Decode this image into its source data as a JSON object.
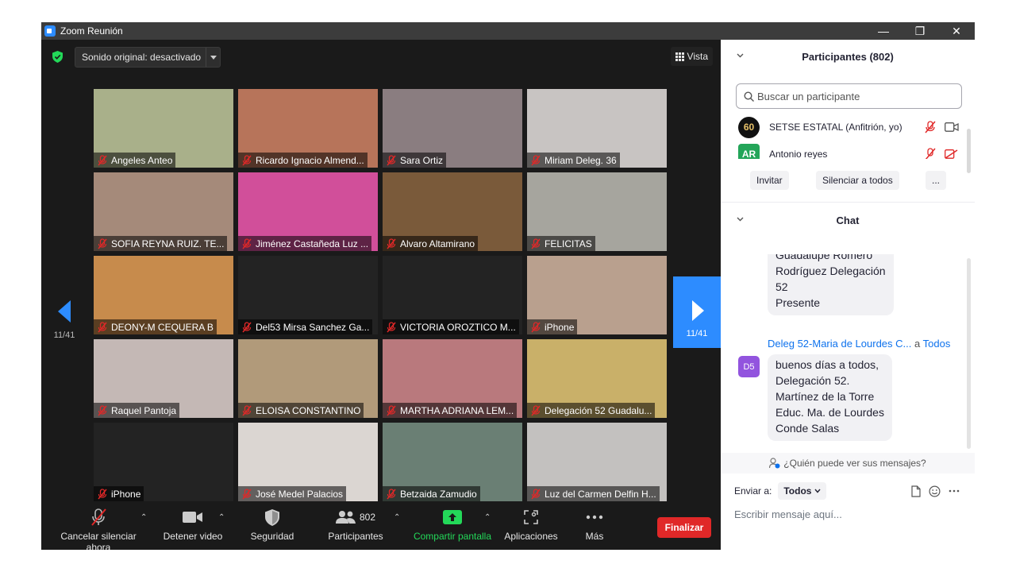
{
  "window": {
    "title": "Zoom Reunión",
    "minimize": "—",
    "restore": "❐",
    "close": "✕"
  },
  "topbar": {
    "sound_label": "Sonido original: desactivado",
    "view_label": "Vista"
  },
  "colors": {
    "accent": "#2d8cff",
    "danger": "#e02828",
    "muted_mic": "#e02828"
  },
  "grid": {
    "tiles": [
      {
        "name": "Angeles Anteo",
        "bg": "#a9b08a"
      },
      {
        "name": "Ricardo Ignacio Almend...",
        "bg": "#b7745a"
      },
      {
        "name": "Sara Ortiz",
        "bg": "#8a7d80"
      },
      {
        "name": "Miriam Deleg. 36",
        "bg": "#c8c4c2"
      },
      {
        "name": "SOFIA  REYNA  RUIZ. TE...",
        "bg": "#a58a7a"
      },
      {
        "name": "Jiménez Castañeda Luz ...",
        "bg": "#d14f9a"
      },
      {
        "name": "Alvaro Altamirano",
        "bg": "#7a5a3a"
      },
      {
        "name": "FELICITAS",
        "bg": "#a6a59e"
      },
      {
        "name": "DEONY-M CEQUERA B",
        "bg": "#c78b4c"
      },
      {
        "name": "Del53 Mirsa Sanchez Ga...",
        "bg": "#232323"
      },
      {
        "name": "VICTORIA OROZTICO M...",
        "bg": "#232323"
      },
      {
        "name": "iPhone",
        "bg": "#b9a08e"
      },
      {
        "name": "Raquel Pantoja",
        "bg": "#c4b8b5"
      },
      {
        "name": "ELOISA CONSTANTINO",
        "bg": "#b19a7a"
      },
      {
        "name": "MARTHA ADRIANA LEM...",
        "bg": "#b9797d"
      },
      {
        "name": "Delegación 52 Guadalu...",
        "bg": "#c9b069"
      },
      {
        "name": "iPhone",
        "bg": "#232323"
      },
      {
        "name": "José Medel Palacios",
        "bg": "#dbd6d2"
      },
      {
        "name": "Betzaida Zamudio",
        "bg": "#6a7f74"
      },
      {
        "name": "Luz del Carmen Delfin H...",
        "bg": "#c3c1bf"
      }
    ],
    "page_left": "11/41",
    "page_right": "11/41"
  },
  "toolbar": {
    "mute": "Cancelar silenciar ahora",
    "video": "Detener video",
    "security": "Seguridad",
    "participants": "Participantes",
    "participants_count": "802",
    "share": "Compartir pantalla",
    "apps": "Aplicaciones",
    "more": "Más",
    "end": "Finalizar"
  },
  "participants": {
    "title": "Participantes (802)",
    "search_placeholder": "Buscar un participante",
    "rows": [
      {
        "name": "SETSE ESTATAL (Anfitrión, yo)",
        "avatar": "60"
      },
      {
        "name": "Antonio reyes",
        "avatar": "AR"
      }
    ],
    "invite": "Invitar",
    "mute_all": "Silenciar a todos",
    "more": "..."
  },
  "chat": {
    "title": "Chat",
    "msg1_lines": [
      "Guadalupe Romero",
      "Rodríguez Delegación",
      "52",
      "Presente"
    ],
    "msg2_sender": "Deleg 52-Maria de Lourdes C...",
    "msg2_to_word": "a",
    "msg2_to": "Todos",
    "msg2_avatar": "D5",
    "msg2_lines": [
      "buenos días a todos,",
      "Delegación 52.",
      "Martínez de la Torre",
      "Educ. Ma. de Lourdes",
      "Conde Salas"
    ],
    "who_can_see": "¿Quién puede ver sus mensajes?",
    "send_to_label": "Enviar a:",
    "send_to_value": "Todos",
    "compose_placeholder": "Escribir mensaje aquí..."
  }
}
